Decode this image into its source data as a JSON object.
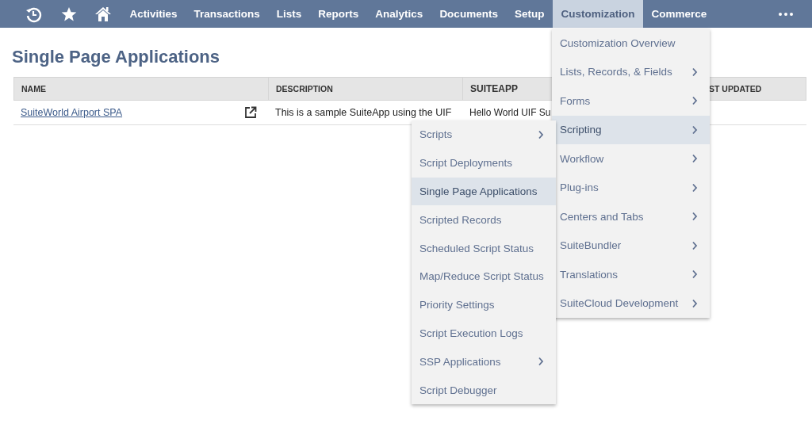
{
  "nav": {
    "items": [
      {
        "label": "Activities",
        "selected": false
      },
      {
        "label": "Transactions",
        "selected": false
      },
      {
        "label": "Lists",
        "selected": false
      },
      {
        "label": "Reports",
        "selected": false
      },
      {
        "label": "Analytics",
        "selected": false
      },
      {
        "label": "Documents",
        "selected": false
      },
      {
        "label": "Setup",
        "selected": false
      },
      {
        "label": "Customization",
        "selected": true
      },
      {
        "label": "Commerce",
        "selected": false
      }
    ]
  },
  "page_title": "Single Page Applications",
  "table": {
    "columns": [
      "NAME",
      "DESCRIPTION",
      "SUITEAPP",
      "ST UPDATED"
    ],
    "rows": [
      {
        "name": "SuiteWorld Airport SPA",
        "description": "This is a sample SuiteApp using the UIF",
        "suiteapp": "Hello World UIF Su"
      }
    ]
  },
  "menu": {
    "items": [
      {
        "label": "Customization Overview",
        "has_submenu": false,
        "selected": false
      },
      {
        "label": "Lists, Records, & Fields",
        "has_submenu": true,
        "selected": false
      },
      {
        "label": "Forms",
        "has_submenu": true,
        "selected": false
      },
      {
        "label": "Scripting",
        "has_submenu": true,
        "selected": true
      },
      {
        "label": "Workflow",
        "has_submenu": true,
        "selected": false
      },
      {
        "label": "Plug-ins",
        "has_submenu": true,
        "selected": false
      },
      {
        "label": "Centers and Tabs",
        "has_submenu": true,
        "selected": false
      },
      {
        "label": "SuiteBundler",
        "has_submenu": true,
        "selected": false
      },
      {
        "label": "Translations",
        "has_submenu": true,
        "selected": false
      },
      {
        "label": "SuiteCloud Development",
        "has_submenu": true,
        "selected": false
      }
    ]
  },
  "submenu": {
    "items": [
      {
        "label": "Scripts",
        "has_submenu": true,
        "selected": false
      },
      {
        "label": "Script Deployments",
        "has_submenu": false,
        "selected": false
      },
      {
        "label": "Single Page Applications",
        "has_submenu": false,
        "selected": true
      },
      {
        "label": "Scripted Records",
        "has_submenu": false,
        "selected": false
      },
      {
        "label": "Scheduled Script Status",
        "has_submenu": false,
        "selected": false
      },
      {
        "label": "Map/Reduce Script Status",
        "has_submenu": false,
        "selected": false
      },
      {
        "label": "Priority Settings",
        "has_submenu": false,
        "selected": false
      },
      {
        "label": "Script Execution Logs",
        "has_submenu": false,
        "selected": false
      },
      {
        "label": "SSP Applications",
        "has_submenu": true,
        "selected": false
      },
      {
        "label": "Script Debugger",
        "has_submenu": false,
        "selected": false
      }
    ]
  }
}
